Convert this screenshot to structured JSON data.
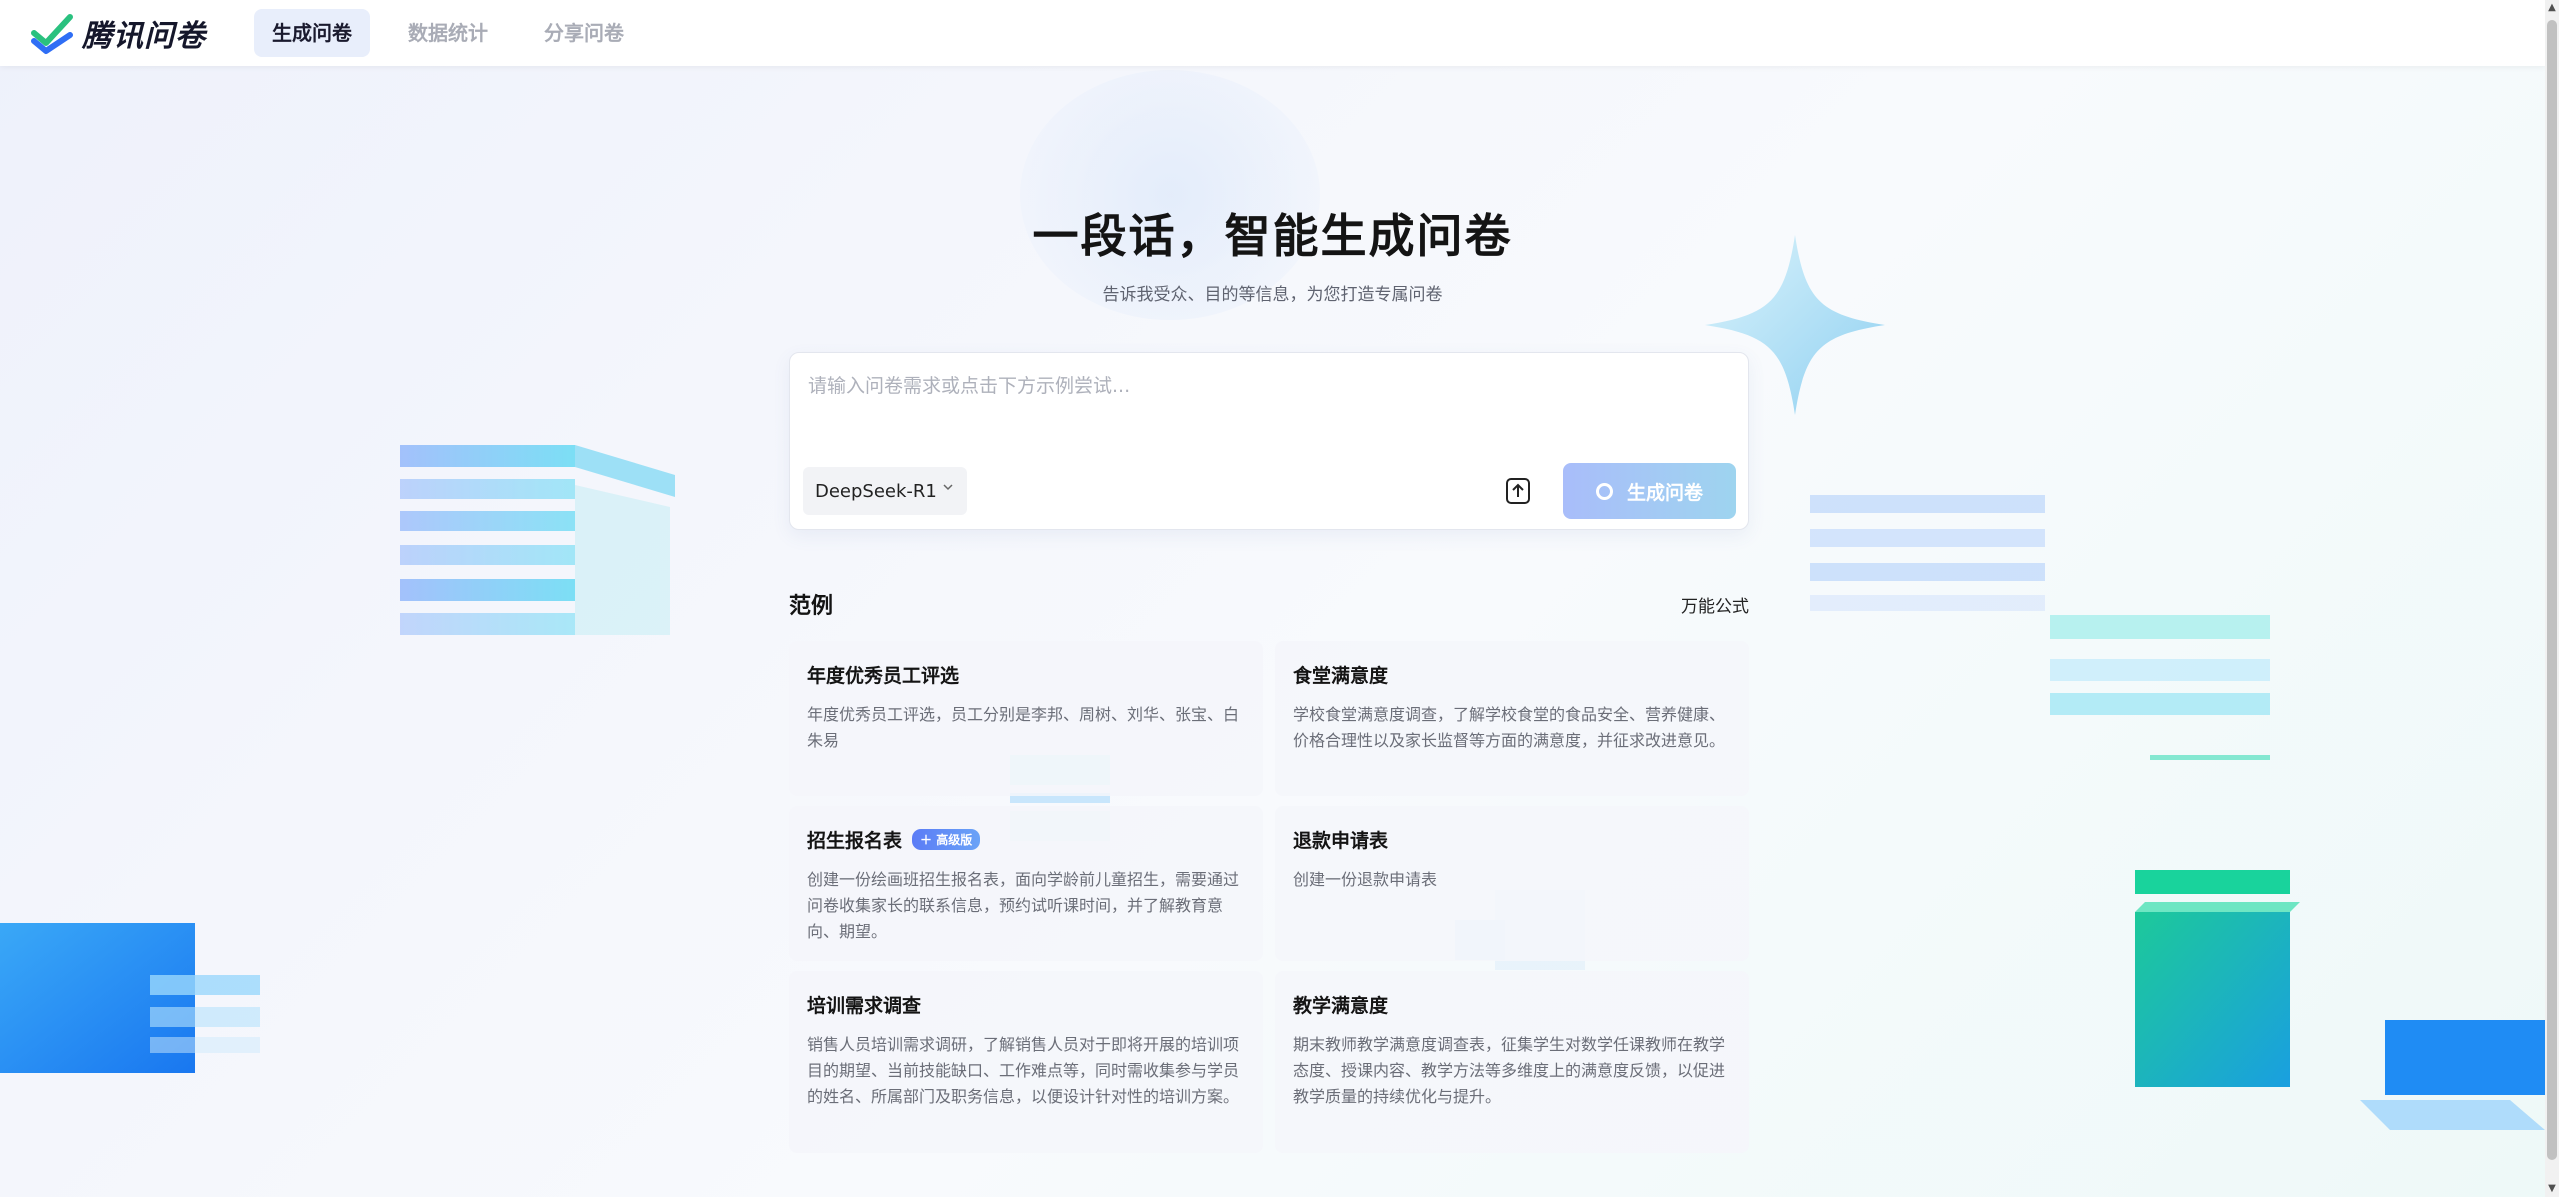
{
  "app": {
    "name": "腾讯问卷"
  },
  "nav": [
    {
      "label": "生成问卷",
      "active": true
    },
    {
      "label": "数据统计",
      "active": false
    },
    {
      "label": "分享问卷",
      "active": false
    }
  ],
  "hero": {
    "title": "一段话，智能生成问卷",
    "subtitle": "告诉我受众、目的等信息，为您打造专属问卷"
  },
  "input": {
    "placeholder": "请输入问卷需求或点击下方示例尝试...",
    "value": "",
    "model": "DeepSeek-R1",
    "generate_label": "生成问卷"
  },
  "examples": {
    "title": "范例",
    "link": "万能公式",
    "cards": [
      {
        "title": "年度优秀员工评选",
        "desc": "年度优秀员工评选，员工分别是李邦、周树、刘华、张宝、白朱易"
      },
      {
        "title": "食堂满意度",
        "desc": "学校食堂满意度调查，了解学校食堂的食品安全、营养健康、价格合理性以及家长监督等方面的满意度，并征求改进意见。"
      },
      {
        "title": "招生报名表",
        "badge": "高级版",
        "desc": "创建一份绘画班招生报名表，面向学龄前儿童招生，需要通过问卷收集家长的联系信息，预约试听课时间，并了解教育意向、期望。"
      },
      {
        "title": "退款申请表",
        "desc": "创建一份退款申请表"
      },
      {
        "title": "培训需求调查",
        "desc": "销售人员培训需求调研，了解销售人员对于即将开展的培训项目的期望、当前技能缺口、工作难点等，同时需收集参与学员的姓名、所属部门及职务信息，以便设计针对性的培训方案。"
      },
      {
        "title": "教学满意度",
        "desc": "期末教师教学满意度调查表，征集学生对数学任课教师在教学态度、授课内容、教学方法等多维度上的满意度反馈，以促进教学质量的持续优化与提升。"
      }
    ]
  },
  "colors": {
    "accent": "#5b7cf6",
    "generate_gradient_start": "#a9bdfa",
    "generate_gradient_end": "#9ed4ef"
  }
}
